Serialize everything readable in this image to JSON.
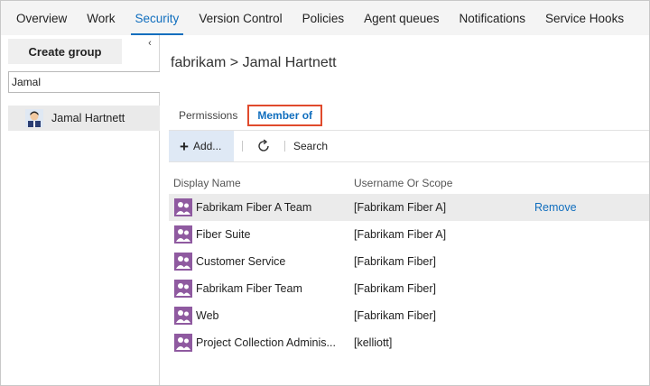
{
  "tabs": [
    {
      "label": "Overview",
      "active": false
    },
    {
      "label": "Work",
      "active": false
    },
    {
      "label": "Security",
      "active": true
    },
    {
      "label": "Version Control",
      "active": false
    },
    {
      "label": "Policies",
      "active": false
    },
    {
      "label": "Agent queues",
      "active": false
    },
    {
      "label": "Notifications",
      "active": false
    },
    {
      "label": "Service Hooks",
      "active": false
    }
  ],
  "sidebar": {
    "create_group_label": "Create group",
    "collapse_icon": "chevron-left-icon",
    "search_value": "Jamal",
    "selected_user": "Jamal Hartnett"
  },
  "breadcrumb": "fabrikam > Jamal Hartnett",
  "subtabs": {
    "permissions": "Permissions",
    "member_of": "Member of"
  },
  "toolbar": {
    "add_label": "Add...",
    "refresh_icon": "refresh-icon",
    "search_label": "Search"
  },
  "grid": {
    "headers": {
      "display_name": "Display Name",
      "scope": "Username Or Scope"
    },
    "rows": [
      {
        "name": "Fabrikam Fiber A Team",
        "scope": "[Fabrikam Fiber A]",
        "action": "Remove"
      },
      {
        "name": "Fiber Suite",
        "scope": "[Fabrikam Fiber A]",
        "action": ""
      },
      {
        "name": "Customer Service",
        "scope": "[Fabrikam Fiber]",
        "action": ""
      },
      {
        "name": "Fabrikam Fiber Team",
        "scope": "[Fabrikam Fiber]",
        "action": ""
      },
      {
        "name": "Web",
        "scope": "[Fabrikam Fiber]",
        "action": ""
      },
      {
        "name": "Project Collection Adminis...",
        "scope": "[kelliott]",
        "action": ""
      }
    ]
  },
  "colors": {
    "accent": "#106ebe",
    "highlight_border": "#e04a2c",
    "group_icon": "#8f5aa0"
  }
}
